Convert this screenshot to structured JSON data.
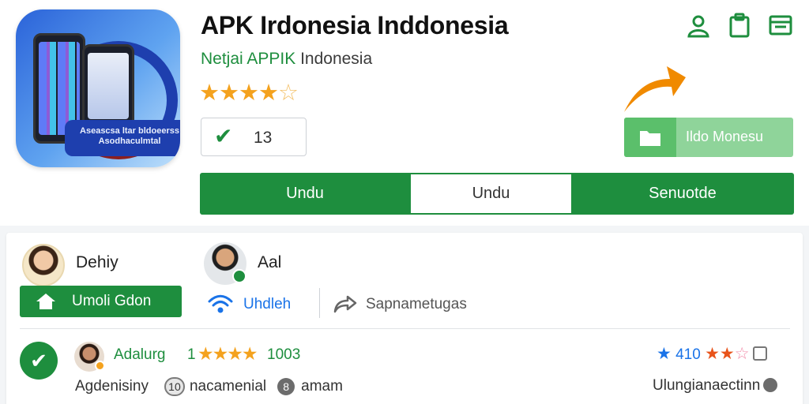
{
  "app": {
    "title": "APK Irdonesia Inddonesia",
    "developer": "Netjai APPIK",
    "country": "Indonesia",
    "icon_banner_line1": "Aseascsa ltar bldoeerss",
    "icon_banner_line2": "Asodhaculmtal",
    "rating_stars": 4,
    "rating_max": 5,
    "count_value": "13"
  },
  "header_icons": [
    "person-icon",
    "clipboard-icon",
    "folder-icon"
  ],
  "install_button": {
    "label": "Ildo Monesu"
  },
  "tabs": [
    {
      "label": "Undu",
      "active": false
    },
    {
      "label": "Undu",
      "active": true
    },
    {
      "label": "Senuotde",
      "active": false
    }
  ],
  "users": [
    {
      "name": "Dehiy"
    },
    {
      "name": "Aal"
    }
  ],
  "actions": {
    "follow_label": "Umoli Gdon",
    "wifi_label": "Uhdleh",
    "share_label": "Sapnametugas"
  },
  "review": {
    "name": "Adalurg",
    "prefix": "1",
    "stars": 4,
    "count": "1003",
    "right_rating_value": "410",
    "meta_left": "Agdenisiny",
    "meta_badge": "10",
    "meta_mid": "nacamenial",
    "meta_gear": "8",
    "meta_end": "amam",
    "meta_right": "Ulungianaectinn"
  },
  "colors": {
    "brand_green": "#1e8e3e",
    "install_green": "#8fd49a",
    "star_gold": "#f4a21e",
    "link_blue": "#1a73e8",
    "arrow_orange": "#f08a00"
  }
}
